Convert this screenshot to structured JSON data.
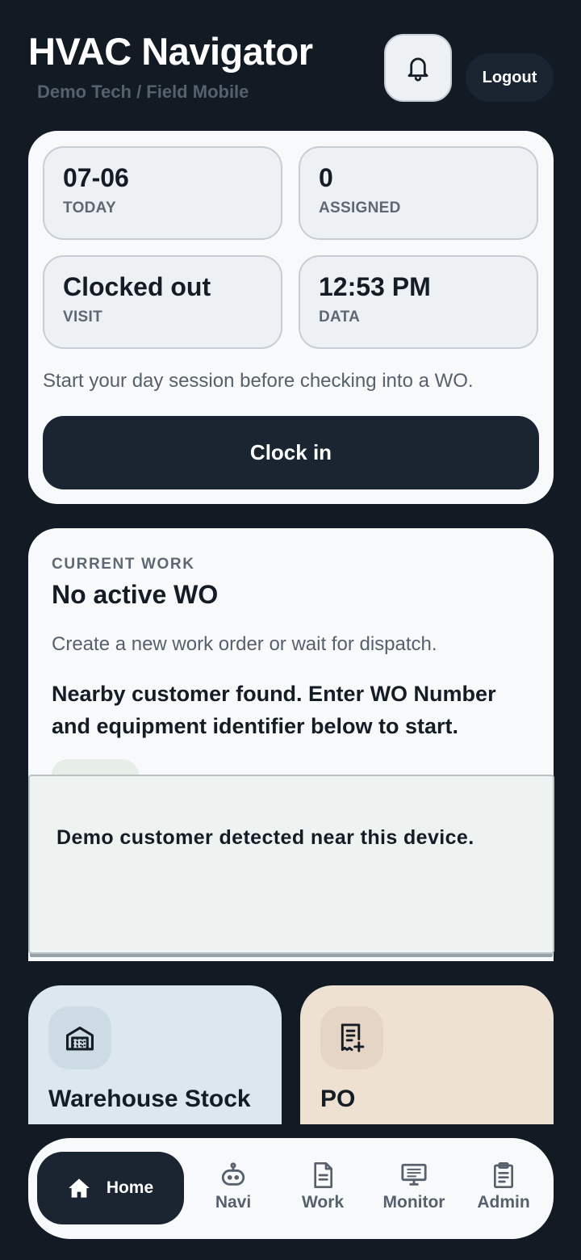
{
  "header": {
    "title": "HVAC Navigator",
    "subtitle": "Demo Tech / Field Mobile",
    "logout_label": "Logout"
  },
  "status": {
    "tiles": [
      {
        "value": "07-06",
        "label": "TODAY"
      },
      {
        "value": "0",
        "label": "ASSIGNED"
      },
      {
        "value": "Clocked out",
        "label": "VISIT"
      },
      {
        "value": "12:53 PM",
        "label": "DATA"
      }
    ],
    "hint": "Start your day session before checking into a WO.",
    "clock_in_label": "Clock in"
  },
  "current_work": {
    "eyebrow": "CURRENT WORK",
    "title": "No active WO",
    "description": "Create a new work order or wait for dispatch.",
    "notice": "Nearby customer found. Enter WO Number and equipment identifier below to start."
  },
  "toast": {
    "message": "Demo customer detected near this device."
  },
  "shortcuts": [
    {
      "label": "Warehouse Stock",
      "icon": "warehouse-icon"
    },
    {
      "label": "PO",
      "icon": "purchase-order-icon"
    }
  ],
  "nav": {
    "items": [
      {
        "label": "Home",
        "icon": "home-icon"
      },
      {
        "label": "Navi",
        "icon": "robot-icon"
      },
      {
        "label": "Work",
        "icon": "document-icon"
      },
      {
        "label": "Monitor",
        "icon": "monitor-icon"
      },
      {
        "label": "Admin",
        "icon": "clipboard-icon"
      }
    ],
    "active": "Home"
  },
  "colors": {
    "background": "#121a24",
    "card": "#f8f9fb",
    "primary_dark": "#1a2531",
    "warehouse_tile": "#dce7f0",
    "po_tile": "#efe1d2"
  }
}
